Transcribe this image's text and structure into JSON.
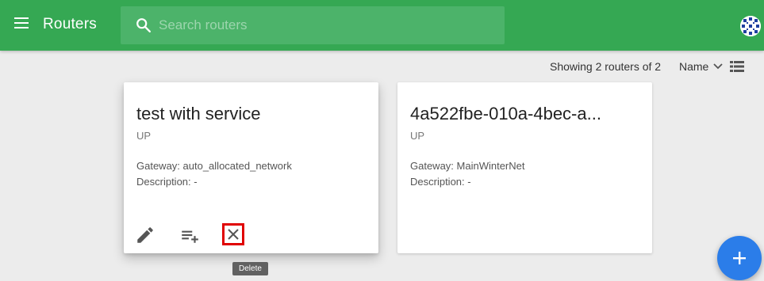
{
  "header": {
    "title": "Routers",
    "search_placeholder": "Search routers",
    "search_value": ""
  },
  "toolbar": {
    "count_text": "Showing 2 routers of 2",
    "sort_label": "Name"
  },
  "cards": [
    {
      "title": "test with service",
      "status": "UP",
      "gateway": "Gateway: auto_allocated_network",
      "description": "Description: -"
    },
    {
      "title": "4a522fbe-010a-4bec-a...",
      "status": "UP",
      "gateway": "Gateway: MainWinterNet",
      "description": "Description: -"
    }
  ],
  "tooltip": "Delete",
  "colors": {
    "header": "#35a853",
    "fab": "#2b7de9",
    "highlight": "#e00000"
  },
  "icons": [
    "menu-icon",
    "search-icon",
    "avatar",
    "chevron-down-icon",
    "list-view-icon",
    "edit-icon",
    "playlist-add-icon",
    "close-icon",
    "plus-icon"
  ]
}
